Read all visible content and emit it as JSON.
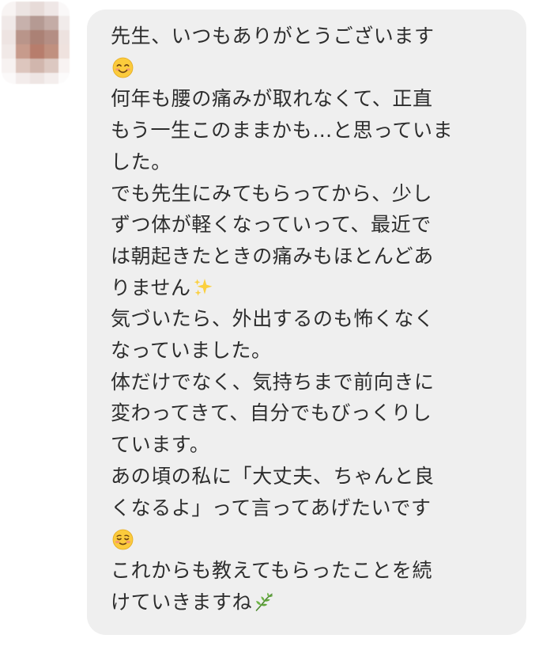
{
  "message": {
    "lines": [
      "先生、いつもありがとうございます",
      "",
      "何年も腰の痛みが取れなくて、正直",
      "もう一生このままかも…と思っていま",
      "した。",
      "でも先生にみてもらってから、少し",
      "ずつ体が軽くなっていって、最近で",
      "は朝起きたときの痛みもほとんどあ",
      "りません",
      "気づいたら、外出するのも怖くなく",
      "なっていました。",
      "体だけでなく、気持ちまで前向きに",
      "変わってきて、自分でもびっくりし",
      "ています。",
      "あの頃の私に「大丈夫、ちゃんと良",
      "くなるよ」って言ってあげたいです",
      "",
      "これからも教えてもらったことを続",
      "けていきますね"
    ],
    "emojis": {
      "smile": "smiling-face-icon",
      "sparkles": "sparkles-icon",
      "blush": "relieved-smiling-face-icon",
      "herb": "herb-icon"
    }
  },
  "colors": {
    "bubble": "#efefef",
    "text": "#2d2d2d"
  }
}
